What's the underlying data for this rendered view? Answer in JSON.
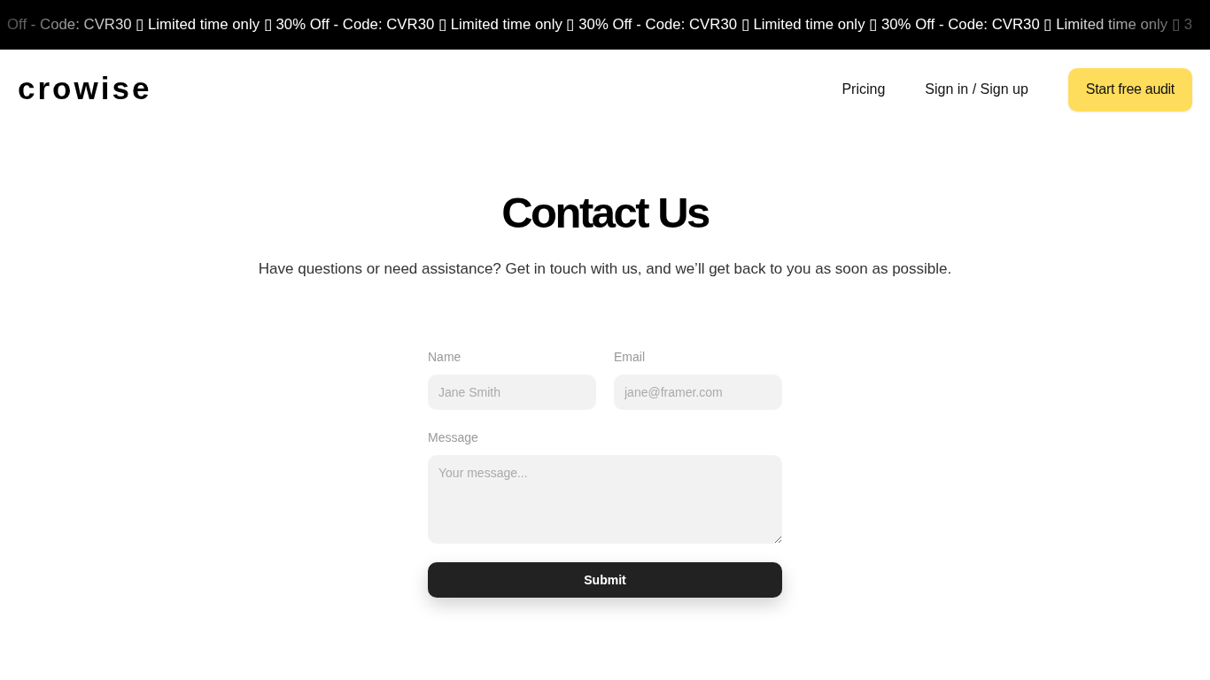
{
  "promo_banner": {
    "text": "Off - Code: CVR30 ▯ Limited time only ▯ 30% Off - Code: CVR30 ▯ Limited time only ▯ 30% Off - Code: CVR30 ▯ Limited time only ▯ 30% Off - Code: CVR30 ▯ Limited time only ▯ 3"
  },
  "header": {
    "logo": "crowise",
    "nav": [
      {
        "label": "Pricing"
      },
      {
        "label": "Sign in / Sign up"
      }
    ],
    "cta": "Start free audit"
  },
  "hero": {
    "title": "Contact Us",
    "subtitle": "Have questions or need assistance? Get in touch with us, and we’ll get back to you as soon as possible."
  },
  "form": {
    "fields": [
      {
        "kind": "input",
        "label": "Name",
        "placeholder": "Jane Smith"
      },
      {
        "kind": "input",
        "label": "Email",
        "placeholder": "jane@framer.com"
      },
      {
        "kind": "textarea",
        "label": "Message",
        "placeholder": "Your message..."
      }
    ],
    "submit": "Submit"
  }
}
